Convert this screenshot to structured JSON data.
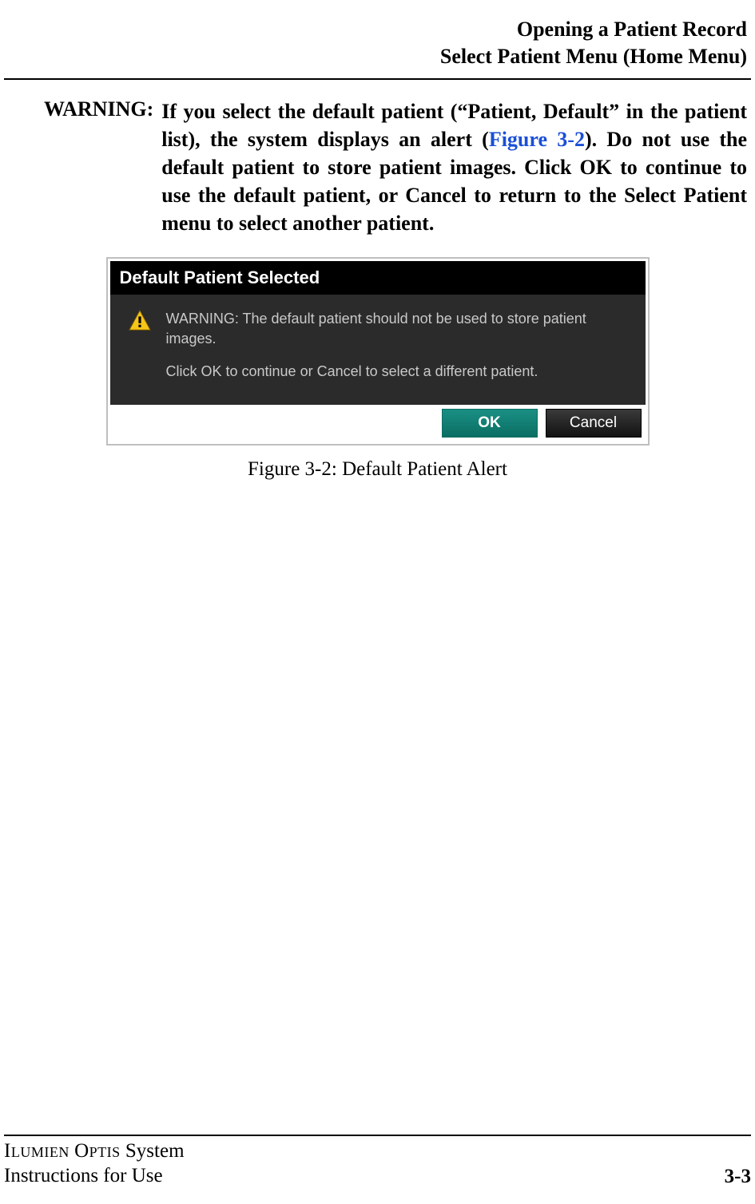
{
  "header": {
    "line1": "Opening a Patient Record",
    "line2": "Select Patient Menu (Home Menu)"
  },
  "warning": {
    "label": "WARNING:",
    "text_before_link": "If you select the default patient (“Patient, Default” in the patient list), the system displays an alert (",
    "link": "Figure 3-2",
    "text_after_link": "). Do not use the default patient to store patient images. Click OK to continue to use the default patient, or Cancel to return to the Select Patient menu to select another patient."
  },
  "dialog": {
    "title": "Default Patient Selected",
    "line1": "WARNING: The default patient should not be used to store patient images.",
    "line2": "Click OK to continue or Cancel to select a different patient.",
    "ok": "OK",
    "cancel": "Cancel"
  },
  "figure_caption": "Figure 3-2:  Default Patient Alert",
  "footer": {
    "line1_sc1": "Ilumien",
    "line1_sc2": "Optis",
    "line1_rest": " System",
    "line2": "Instructions for Use",
    "page": "3-3"
  }
}
